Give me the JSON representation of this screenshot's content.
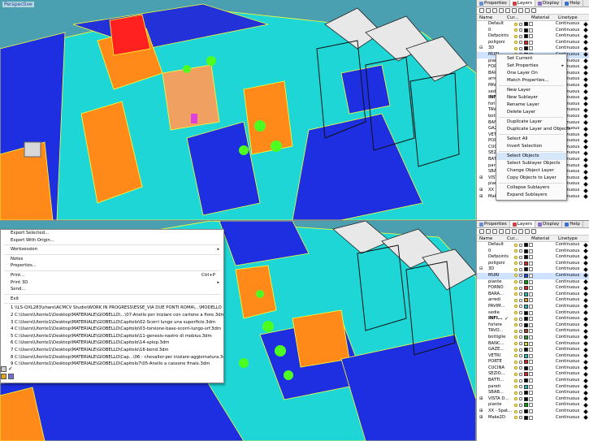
{
  "top": {
    "viewport_label": "Perspective",
    "tabs": [
      {
        "label": "Properties",
        "icon": "properties-icon",
        "color": "#6a8fd0"
      },
      {
        "label": "Layers",
        "icon": "layers-icon",
        "color": "#d04040"
      },
      {
        "label": "Display",
        "icon": "display-icon",
        "color": "#8a6fc0"
      },
      {
        "label": "Help",
        "icon": "help-icon",
        "color": "#3a70d0"
      }
    ],
    "columns": {
      "name": "Name",
      "current": "Cur...",
      "material": "Material",
      "linetype": "Linetype"
    },
    "layers": [
      {
        "name": "Default",
        "expander": "",
        "current": "",
        "color": "#000000",
        "linetype": "Continuous",
        "selected": false,
        "bold": false
      },
      {
        "name": "0",
        "expander": "",
        "current": "",
        "color": "#000000",
        "linetype": "Continuous",
        "selected": false,
        "bold": false
      },
      {
        "name": "Defpoints",
        "expander": "",
        "current": "",
        "color": "#000000",
        "linetype": "Continuous",
        "selected": false,
        "bold": false
      },
      {
        "name": "poligoni",
        "expander": "",
        "current": "",
        "color": "#e02020",
        "linetype": "Continuous",
        "selected": false,
        "bold": false
      },
      {
        "name": "3D",
        "expander": "⊟",
        "current": "",
        "color": "#000000",
        "linetype": "Continuous",
        "selected": false,
        "bold": false
      },
      {
        "name": "MURI",
        "expander": "",
        "current": "",
        "color": "#2040e0",
        "linetype": "Continuous",
        "selected": true,
        "bold": false
      },
      {
        "name": "piante",
        "expander": "",
        "current": "",
        "color": "#00a000",
        "linetype": "Continuous",
        "selected": false,
        "bold": false
      },
      {
        "name": "FORNO",
        "expander": "",
        "current": "",
        "color": "#e02020",
        "linetype": "Continuous",
        "selected": false,
        "bold": false
      },
      {
        "name": "BARA...",
        "expander": "",
        "current": "",
        "color": "#20c0c0",
        "linetype": "Continuous",
        "selected": false,
        "bold": false
      },
      {
        "name": "arredi",
        "expander": "",
        "current": "",
        "color": "#e0a020",
        "linetype": "Continuous",
        "selected": false,
        "bold": false
      },
      {
        "name": "PAVIM...",
        "expander": "",
        "current": "",
        "color": "#20c0c0",
        "linetype": "Continuous",
        "selected": false,
        "bold": false
      },
      {
        "name": "sedie",
        "expander": "",
        "current": "",
        "color": "#000000",
        "linetype": "Continuous",
        "selected": false,
        "bold": false
      },
      {
        "name": "INFI...",
        "expander": "",
        "current": "✓",
        "color": "#000000",
        "linetype": "Continuous",
        "selected": false,
        "bold": true
      },
      {
        "name": "forlere",
        "expander": "",
        "current": "",
        "color": "#000000",
        "linetype": "Continuous",
        "selected": false,
        "bold": false
      },
      {
        "name": "TAVO...",
        "expander": "",
        "current": "",
        "color": "#a04020",
        "linetype": "Continuous",
        "selected": false,
        "bold": false
      },
      {
        "name": "bottiglie",
        "expander": "",
        "current": "",
        "color": "#20a020",
        "linetype": "Continuous",
        "selected": false,
        "bold": false
      },
      {
        "name": "BANC...",
        "expander": "",
        "current": "",
        "color": "#e0e020",
        "linetype": "Continuous",
        "selected": false,
        "bold": false
      },
      {
        "name": "GAZE...",
        "expander": "",
        "current": "",
        "color": "#000000",
        "linetype": "Continuous",
        "selected": false,
        "bold": false
      },
      {
        "name": "VETRI",
        "expander": "",
        "current": "",
        "color": "#20c0c0",
        "linetype": "Continuous",
        "selected": false,
        "bold": false
      },
      {
        "name": "PORTE",
        "expander": "",
        "current": "",
        "color": "#e02020",
        "linetype": "Continuous",
        "selected": false,
        "bold": false
      },
      {
        "name": "CUCINA",
        "expander": "",
        "current": "",
        "color": "#000000",
        "linetype": "Continuous",
        "selected": false,
        "bold": false
      },
      {
        "name": "SEZIO...",
        "expander": "",
        "current": "",
        "color": "#e02020",
        "linetype": "Continuous",
        "selected": false,
        "bold": false
      },
      {
        "name": "BATTI...",
        "expander": "",
        "current": "",
        "color": "#000000",
        "linetype": "Continuous",
        "selected": false,
        "bold": false
      },
      {
        "name": "pareti",
        "expander": "",
        "current": "",
        "color": "#20c0c0",
        "linetype": "Continuous",
        "selected": false,
        "bold": false
      },
      {
        "name": "SBAB...",
        "expander": "",
        "current": "",
        "color": "#000000",
        "linetype": "Continuous",
        "selected": false,
        "bold": false
      },
      {
        "name": "VISTA D...",
        "expander": "⊞",
        "current": "",
        "color": "#000000",
        "linetype": "Continuous",
        "selected": false,
        "bold": false
      },
      {
        "name": "piante",
        "expander": "",
        "current": "",
        "color": "#00a000",
        "linetype": "Continuous",
        "selected": false,
        "bold": false
      },
      {
        "name": "XX - Spat...",
        "expander": "⊞",
        "current": "",
        "color": "#000000",
        "linetype": "Continuous",
        "selected": false,
        "bold": false
      },
      {
        "name": "Make2D",
        "expander": "⊞",
        "current": "",
        "color": "#000000",
        "linetype": "Continuous",
        "selected": false,
        "bold": false
      }
    ],
    "context_menu": [
      {
        "label": "Set Current",
        "submenu": false,
        "highlighted": false
      },
      {
        "label": "Set Properties",
        "submenu": true,
        "highlighted": false
      },
      {
        "label": "One Layer On",
        "submenu": false,
        "highlighted": false
      },
      {
        "label": "Match Properties...",
        "submenu": false,
        "highlighted": false
      },
      {
        "sep": true
      },
      {
        "label": "New Layer",
        "submenu": false,
        "highlighted": false
      },
      {
        "label": "New Sublayer",
        "submenu": false,
        "highlighted": false
      },
      {
        "label": "Rename Layer",
        "submenu": false,
        "highlighted": false
      },
      {
        "label": "Delete Layer",
        "submenu": false,
        "highlighted": false
      },
      {
        "sep": true
      },
      {
        "label": "Duplicate Layer",
        "submenu": false,
        "highlighted": false
      },
      {
        "label": "Duplicate Layer and Objects",
        "submenu": false,
        "highlighted": false
      },
      {
        "sep": true
      },
      {
        "label": "Select All",
        "submenu": false,
        "highlighted": false
      },
      {
        "label": "Invert Selection",
        "submenu": false,
        "highlighted": false
      },
      {
        "sep": true
      },
      {
        "label": "Select Objects",
        "submenu": false,
        "highlighted": true
      },
      {
        "label": "Select Sublayer Objects",
        "submenu": false,
        "highlighted": false
      },
      {
        "label": "Change Object Layer",
        "submenu": false,
        "highlighted": false
      },
      {
        "label": "Copy Objects to Layer",
        "submenu": false,
        "highlighted": false
      },
      {
        "sep": true
      },
      {
        "label": "Collapse Sublayers",
        "submenu": false,
        "highlighted": false
      },
      {
        "label": "Expand Sublayers",
        "submenu": false,
        "highlighted": false
      }
    ]
  },
  "bottom": {
    "tabs": [
      {
        "label": "Properties",
        "icon": "properties-icon",
        "color": "#6a8fd0"
      },
      {
        "label": "Layers",
        "icon": "layers-icon",
        "color": "#d04040"
      },
      {
        "label": "Display",
        "icon": "display-icon",
        "color": "#8a6fc0"
      },
      {
        "label": "Help",
        "icon": "help-icon",
        "color": "#3a70d0"
      }
    ],
    "file_menu": [
      {
        "label": "Export Selected...",
        "shortcut": "",
        "submenu": false
      },
      {
        "label": "Export With Origin...",
        "shortcut": "",
        "submenu": false
      },
      {
        "sep": true
      },
      {
        "label": "Worksession",
        "shortcut": "",
        "submenu": true
      },
      {
        "sep": true
      },
      {
        "label": "Notes",
        "shortcut": "",
        "submenu": false
      },
      {
        "label": "Properties...",
        "shortcut": "",
        "submenu": false
      },
      {
        "sep": true
      },
      {
        "label": "Print...",
        "shortcut": "Ctrl+P",
        "submenu": false
      },
      {
        "label": "Print 3D",
        "shortcut": "",
        "submenu": true
      },
      {
        "label": "Send...",
        "shortcut": "",
        "submenu": false
      },
      {
        "sep": true
      },
      {
        "label": "Exit",
        "shortcut": "",
        "submenu": false
      },
      {
        "sep": true
      },
      {
        "label": "1 \\\\LS-QXL283\\share\\ACMCV Studio\\WORK IN PROGRESS\\ESSE_VIA DUE PONTI ROMA\\...\\MODELLO RHINO.3dm",
        "shortcut": "",
        "submenu": false
      },
      {
        "label": "2 C:\\Users\\Utente1\\Desktop\\MATERIALE\\GIOBELLO\\...\\07-Anello per iniziare con cartone a fiore.3dm",
        "shortcut": "",
        "submenu": false
      },
      {
        "label": "3 C:\\Users\\Utente1\\Desktop\\MATERIALE\\GIOBELLO\\Capitolo\\02-Scorri lungo una superficie.3dm",
        "shortcut": "",
        "submenu": false
      },
      {
        "label": "4 C:\\Users\\Utente1\\Desktop\\MATERIALE\\GIOBELLO\\Capitolo\\03-torsione-base-scorri-lungo-srf.3dm",
        "shortcut": "",
        "submenu": false
      },
      {
        "label": "5 C:\\Users\\Utente1\\Desktop\\MATERIALE\\GIOBELLO\\Capitolo\\11-genesis-nastro di mobius.3dm",
        "shortcut": "",
        "submenu": false
      },
      {
        "label": "6 C:\\Users\\Utente1\\Desktop\\MATERIALE\\GIOBELLO\\Capitolo\\14-splop.3dm",
        "shortcut": "",
        "submenu": false
      },
      {
        "label": "7 C:\\Users\\Utente1\\Desktop\\MATERIALE\\GIOBELLO\\Capitolo\\16-bend.3dm",
        "shortcut": "",
        "submenu": false
      },
      {
        "label": "8 C:\\Users\\Utente1\\Desktop\\MATERIALE\\GIOBELLO\\Cap...\\06 - chevalier-per iniziare-aggiornatura.3dm",
        "shortcut": "",
        "submenu": false
      },
      {
        "label": "9 C:\\Users\\Utente1\\Desktop\\MATERIALE\\GIOBELLO\\Capitolo7\\05-Anello a cassone finale.3dm",
        "shortcut": "",
        "submenu": false
      }
    ],
    "layers": [
      {
        "name": "Default",
        "expander": "",
        "current": "",
        "color": "#000000",
        "linetype": "Continuous",
        "selected": false,
        "bold": false
      },
      {
        "name": "0",
        "expander": "",
        "current": "",
        "color": "#000000",
        "linetype": "Continuous",
        "selected": false,
        "bold": false
      },
      {
        "name": "Defpoints",
        "expander": "",
        "current": "",
        "color": "#000000",
        "linetype": "Continuous",
        "selected": false,
        "bold": false
      },
      {
        "name": "poligoni",
        "expander": "",
        "current": "",
        "color": "#e02020",
        "linetype": "Continuous",
        "selected": false,
        "bold": false
      },
      {
        "name": "3D",
        "expander": "⊟",
        "current": "",
        "color": "#000000",
        "linetype": "Continuous",
        "selected": false,
        "bold": false
      },
      {
        "name": "MURI",
        "expander": "",
        "current": "",
        "color": "#2040e0",
        "linetype": "Continuous",
        "selected": true,
        "bold": false
      },
      {
        "name": "piante",
        "expander": "",
        "current": "",
        "color": "#00a000",
        "linetype": "Continuous",
        "selected": false,
        "bold": false
      },
      {
        "name": "FORNO",
        "expander": "",
        "current": "",
        "color": "#e02020",
        "linetype": "Continuous",
        "selected": false,
        "bold": false
      },
      {
        "name": "BARA...",
        "expander": "",
        "current": "",
        "color": "#20c0c0",
        "linetype": "Continuous",
        "selected": false,
        "bold": false
      },
      {
        "name": "arredi",
        "expander": "",
        "current": "",
        "color": "#e0a020",
        "linetype": "Continuous",
        "selected": false,
        "bold": false
      },
      {
        "name": "PAVIM...",
        "expander": "",
        "current": "",
        "color": "#20c0c0",
        "linetype": "Continuous",
        "selected": false,
        "bold": false
      },
      {
        "name": "sedie",
        "expander": "",
        "current": "",
        "color": "#000000",
        "linetype": "Continuous",
        "selected": false,
        "bold": false
      },
      {
        "name": "INFI...",
        "expander": "",
        "current": "✓",
        "color": "#000000",
        "linetype": "Continuous",
        "selected": false,
        "bold": true
      },
      {
        "name": "forlere",
        "expander": "",
        "current": "",
        "color": "#000000",
        "linetype": "Continuous",
        "selected": false,
        "bold": false
      },
      {
        "name": "TAVO...",
        "expander": "",
        "current": "",
        "color": "#a04020",
        "linetype": "Continuous",
        "selected": false,
        "bold": false
      },
      {
        "name": "bottiglie",
        "expander": "",
        "current": "",
        "color": "#20a020",
        "linetype": "Continuous",
        "selected": false,
        "bold": false
      },
      {
        "name": "BANC...",
        "expander": "",
        "current": "",
        "color": "#e0e020",
        "linetype": "Continuous",
        "selected": false,
        "bold": false
      },
      {
        "name": "GAZE...",
        "expander": "",
        "current": "",
        "color": "#000000",
        "linetype": "Continuous",
        "selected": false,
        "bold": false
      },
      {
        "name": "VETRI",
        "expander": "",
        "current": "",
        "color": "#20c0c0",
        "linetype": "Continuous",
        "selected": false,
        "bold": false
      },
      {
        "name": "PORTE",
        "expander": "",
        "current": "",
        "color": "#e02020",
        "linetype": "Continuous",
        "selected": false,
        "bold": false
      },
      {
        "name": "CUCINA",
        "expander": "",
        "current": "",
        "color": "#000000",
        "linetype": "Continuous",
        "selected": false,
        "bold": false
      },
      {
        "name": "SEZIO...",
        "expander": "",
        "current": "",
        "color": "#e02020",
        "linetype": "Continuous",
        "selected": false,
        "bold": false
      },
      {
        "name": "BATTI...",
        "expander": "",
        "current": "",
        "color": "#000000",
        "linetype": "Continuous",
        "selected": false,
        "bold": false
      },
      {
        "name": "pareti",
        "expander": "",
        "current": "",
        "color": "#20c0c0",
        "linetype": "Continuous",
        "selected": false,
        "bold": false
      },
      {
        "name": "SBAB...",
        "expander": "",
        "current": "",
        "color": "#000000",
        "linetype": "Continuous",
        "selected": false,
        "bold": false
      },
      {
        "name": "VISTA D...",
        "expander": "⊞",
        "current": "",
        "color": "#000000",
        "linetype": "Continuous",
        "selected": false,
        "bold": false
      },
      {
        "name": "piante",
        "expander": "",
        "current": "",
        "color": "#00a000",
        "linetype": "Continuous",
        "selected": false,
        "bold": false
      },
      {
        "name": "XX - Spat...",
        "expander": "⊞",
        "current": "",
        "color": "#000000",
        "linetype": "Continuous",
        "selected": false,
        "bold": false
      },
      {
        "name": "Make2D",
        "expander": "⊞",
        "current": "",
        "color": "#000000",
        "linetype": "Continuous",
        "selected": false,
        "bold": false
      }
    ]
  }
}
